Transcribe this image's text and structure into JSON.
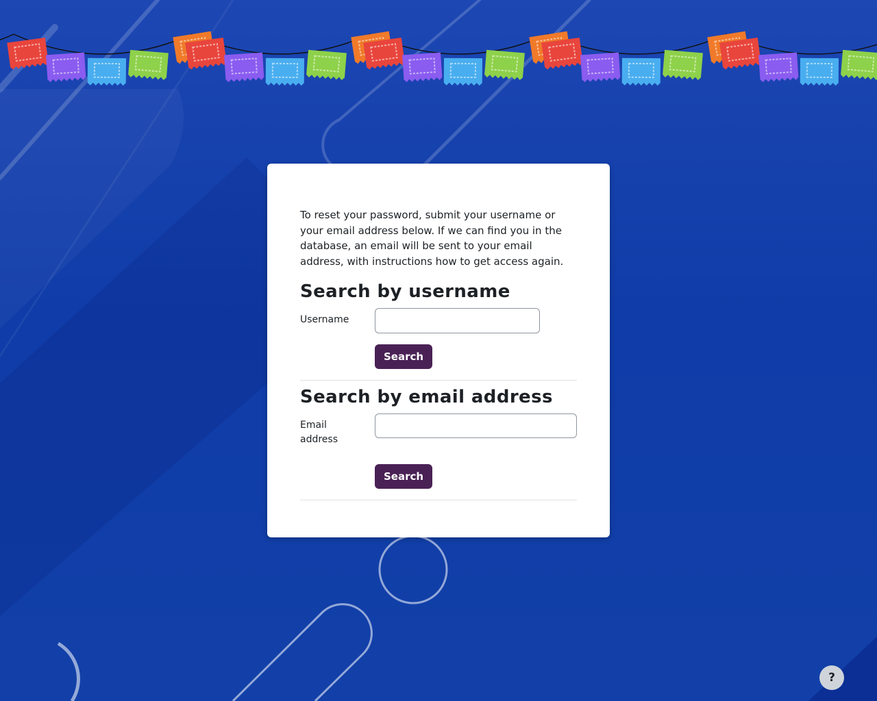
{
  "intro_text": "To reset your password, submit your username or your email address below. If we can find you in the database, an email will be sent to your email address, with instructions how to get access again.",
  "username_section": {
    "heading": "Search by username",
    "label": "Username",
    "value": "",
    "button_label": "Search"
  },
  "email_section": {
    "heading": "Search by email address",
    "label": "Email address",
    "value": "",
    "button_label": "Search"
  },
  "help_button_label": "?",
  "colors": {
    "background": "#1b44b0",
    "button": "#4a2155",
    "bunting": [
      "#e8453c",
      "#8a5cf0",
      "#49aef0",
      "#8ed14a",
      "#f07a2a"
    ]
  },
  "icons": {
    "decor": "papel-picado-bunting",
    "help": "question-mark-icon"
  }
}
